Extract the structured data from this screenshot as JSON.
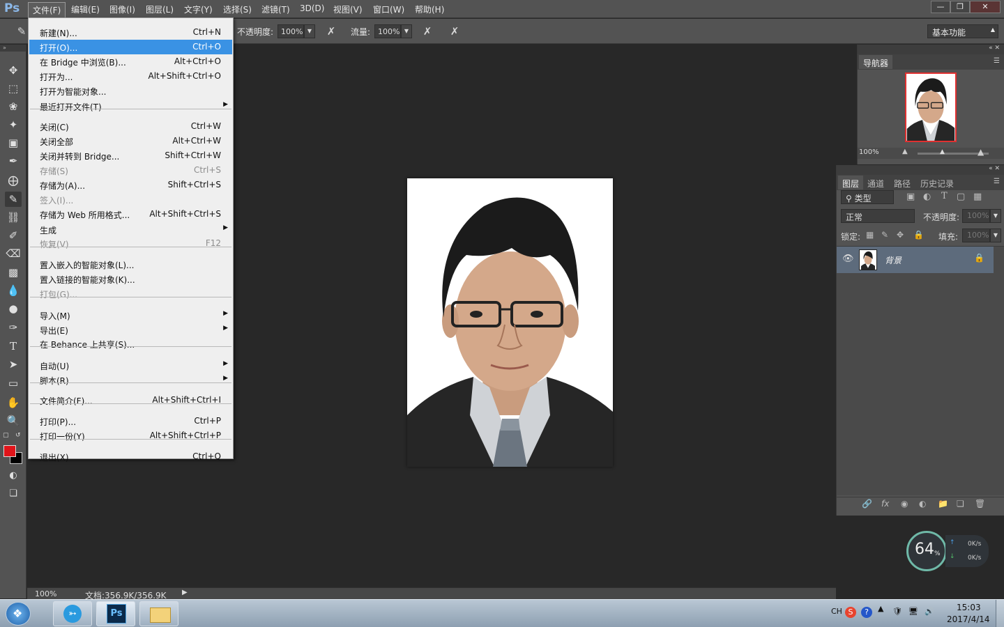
{
  "app": {
    "logo": "Ps",
    "accent": "#3a92e4"
  },
  "menubar": {
    "items": [
      "文件(F)",
      "编辑(E)",
      "图像(I)",
      "图层(L)",
      "文字(Y)",
      "选择(S)",
      "滤镜(T)",
      "3D(D)",
      "视图(V)",
      "窗口(W)",
      "帮助(H)"
    ],
    "active_index": 0
  },
  "options": {
    "opacity_label": "不透明度:",
    "opacity_value": "100%",
    "flow_label": "流量:",
    "flow_value": "100%",
    "workspace": "基本功能"
  },
  "file_menu": {
    "items": [
      {
        "label": "新建(N)...",
        "shortcut": "Ctrl+N"
      },
      {
        "label": "打开(O)...",
        "shortcut": "Ctrl+O",
        "highlighted": true
      },
      {
        "label": "在 Bridge 中浏览(B)...",
        "shortcut": "Alt+Ctrl+O"
      },
      {
        "label": "打开为...",
        "shortcut": "Alt+Shift+Ctrl+O"
      },
      {
        "label": "打开为智能对象...",
        "shortcut": ""
      },
      {
        "label": "最近打开文件(T)",
        "shortcut": "",
        "submenu": true
      },
      {
        "label": "关闭(C)",
        "shortcut": "Ctrl+W"
      },
      {
        "label": "关闭全部",
        "shortcut": "Alt+Ctrl+W"
      },
      {
        "label": "关闭并转到 Bridge...",
        "shortcut": "Shift+Ctrl+W"
      },
      {
        "label": "存储(S)",
        "shortcut": "Ctrl+S",
        "disabled": true
      },
      {
        "label": "存储为(A)...",
        "shortcut": "Shift+Ctrl+S"
      },
      {
        "label": "签入(I)...",
        "shortcut": "",
        "disabled": true
      },
      {
        "label": "存储为 Web 所用格式...",
        "shortcut": "Alt+Shift+Ctrl+S"
      },
      {
        "label": "生成",
        "shortcut": "",
        "submenu": true
      },
      {
        "label": "恢复(V)",
        "shortcut": "F12",
        "disabled": true
      },
      {
        "label": "置入嵌入的智能对象(L)...",
        "shortcut": ""
      },
      {
        "label": "置入链接的智能对象(K)...",
        "shortcut": ""
      },
      {
        "label": "打包(G)...",
        "shortcut": "",
        "disabled": true
      },
      {
        "label": "导入(M)",
        "shortcut": "",
        "submenu": true
      },
      {
        "label": "导出(E)",
        "shortcut": "",
        "submenu": true
      },
      {
        "label": "在 Behance 上共享(S)...",
        "shortcut": ""
      },
      {
        "label": "自动(U)",
        "shortcut": "",
        "submenu": true
      },
      {
        "label": "脚本(R)",
        "shortcut": "",
        "submenu": true
      },
      {
        "label": "文件简介(F)...",
        "shortcut": "Alt+Shift+Ctrl+I"
      },
      {
        "label": "打印(P)...",
        "shortcut": "Ctrl+P"
      },
      {
        "label": "打印一份(Y)",
        "shortcut": "Alt+Shift+Ctrl+P"
      },
      {
        "label": "退出(X)",
        "shortcut": "Ctrl+Q"
      }
    ]
  },
  "navigator": {
    "title": "导航器",
    "zoom": "100%"
  },
  "layers": {
    "tabs": [
      "图层",
      "通道",
      "路径",
      "历史记录"
    ],
    "filter": "类型",
    "blend_mode": "正常",
    "opacity_label": "不透明度:",
    "opacity_value": "100%",
    "lock_label": "锁定:",
    "fill_label": "填充:",
    "fill_value": "100%",
    "layer_name": "背景"
  },
  "status": {
    "zoom": "100%",
    "doc_info": "文档:356.9K/356.9K"
  },
  "speed_widget": {
    "percent": "64",
    "unit": "%",
    "up": "0K/s",
    "down": "0K/s"
  },
  "taskbar": {
    "time": "15:03",
    "date": "2017/4/14",
    "lang": "CH"
  },
  "colors": {
    "foreground": "#e0141a",
    "background": "#000000"
  }
}
